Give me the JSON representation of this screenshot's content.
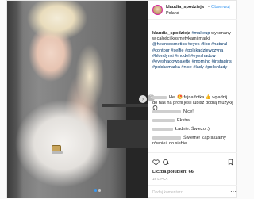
{
  "header": {
    "username": "klaudia_spodzieja",
    "separator": "•",
    "follow_label": "Obserwuj",
    "location": "Poland"
  },
  "caption": {
    "user": "klaudia_spodzieja",
    "text_before_tag": " ",
    "tags_line1": [
      "#makeup"
    ],
    "text_mid": " wykonany w całości kosmetykami marki ",
    "tags": [
      "@heancosmetics",
      "#eyes",
      "#lips",
      "#natural",
      "#contour",
      "#selfie",
      "#polskadziewczyna",
      "#blondynki",
      "#model",
      "#eyeshadow",
      "#eyeshadowpalette",
      "#morning",
      "#instagirls",
      "#polskamarka",
      "#nice",
      "#lady",
      "#polishlady"
    ]
  },
  "comments": [
    {
      "text": "Hej 🤩 fajna fotka 👍 wpadnij"
    },
    {
      "text": "do nas na profil jeśli lubisz dobrą muzykę 🎧"
    },
    {
      "text": "Nice!"
    },
    {
      "text": "Ekstra"
    },
    {
      "text": "Ładnie. Świeżo :)"
    },
    {
      "text": "Świetne! Zapraszamy"
    },
    {
      "text": "również do siebie"
    }
  ],
  "more_comments_label": "2",
  "likes_label": "Liczba polubień: 66",
  "time_label": "18 LIPCA",
  "comment_placeholder": "Dodaj komentarz...",
  "menu_label": "···",
  "carousel_arrow": "›",
  "colors": {
    "accent": "#3897f0",
    "tag": "#003569"
  }
}
